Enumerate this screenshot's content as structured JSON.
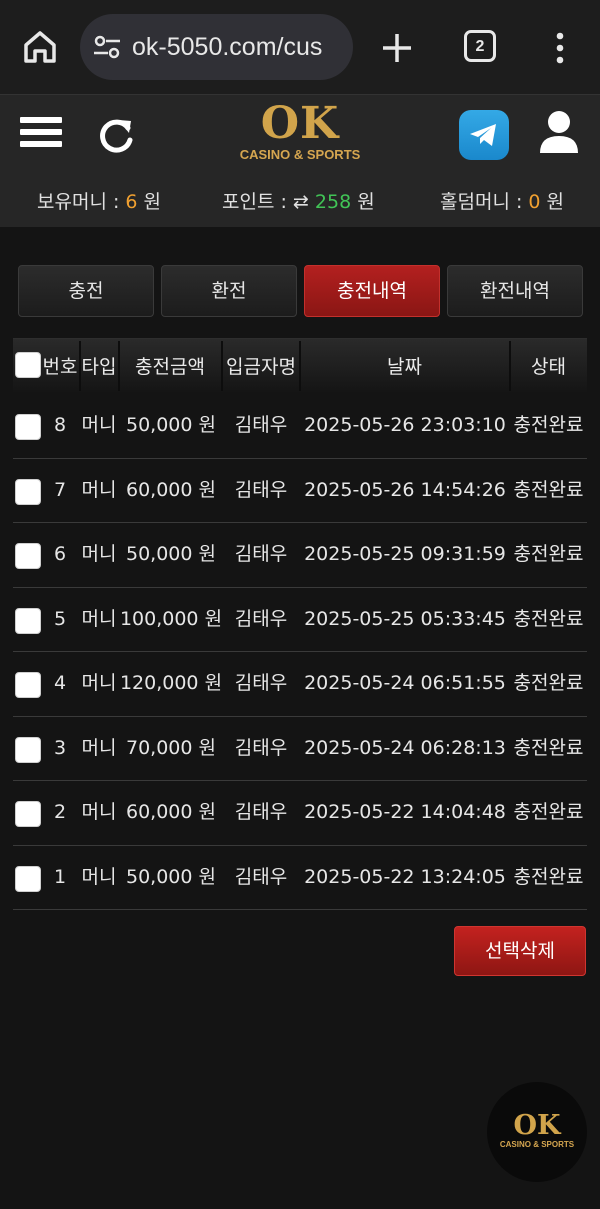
{
  "browser": {
    "url": "ok-5050.com/cus",
    "tab_count": "2"
  },
  "header": {
    "logo_main": "OK",
    "logo_sub": "CASINO & SPORTS",
    "balance": {
      "label": "보유머니 : ",
      "value": "6",
      "unit": " 원"
    },
    "points": {
      "label": "포인트 : ",
      "icon": "⇄",
      "value": "258",
      "unit": " 원"
    },
    "holdem": {
      "label": "홀덤머니 : ",
      "value": "0",
      "unit": " 원"
    },
    "colors": {
      "orange": "#f0a030",
      "green": "#41c456",
      "active_tab": "#a81d1b"
    }
  },
  "tabs": [
    {
      "label": "충전",
      "active": false
    },
    {
      "label": "환전",
      "active": false
    },
    {
      "label": "충전내역",
      "active": true
    },
    {
      "label": "환전내역",
      "active": false
    }
  ],
  "table": {
    "headers": [
      "번호",
      "타입",
      "충전금액",
      "입금자명",
      "날짜",
      "상태"
    ],
    "rows": [
      {
        "no": "8",
        "type": "머니",
        "amount": "50,000 원",
        "depositor": "김태우",
        "date": "2025-05-26 23:03:10",
        "status": "충전완료"
      },
      {
        "no": "7",
        "type": "머니",
        "amount": "60,000 원",
        "depositor": "김태우",
        "date": "2025-05-26 14:54:26",
        "status": "충전완료"
      },
      {
        "no": "6",
        "type": "머니",
        "amount": "50,000 원",
        "depositor": "김태우",
        "date": "2025-05-25 09:31:59",
        "status": "충전완료"
      },
      {
        "no": "5",
        "type": "머니",
        "amount": "100,000 원",
        "depositor": "김태우",
        "date": "2025-05-25 05:33:45",
        "status": "충전완료"
      },
      {
        "no": "4",
        "type": "머니",
        "amount": "120,000 원",
        "depositor": "김태우",
        "date": "2025-05-24 06:51:55",
        "status": "충전완료"
      },
      {
        "no": "3",
        "type": "머니",
        "amount": "70,000 원",
        "depositor": "김태우",
        "date": "2025-05-24 06:28:13",
        "status": "충전완료"
      },
      {
        "no": "2",
        "type": "머니",
        "amount": "60,000 원",
        "depositor": "김태우",
        "date": "2025-05-22 14:04:48",
        "status": "충전완료"
      },
      {
        "no": "1",
        "type": "머니",
        "amount": "50,000 원",
        "depositor": "김태우",
        "date": "2025-05-22 13:24:05",
        "status": "충전완료"
      }
    ]
  },
  "delete_button": "선택삭제",
  "float_logo": {
    "main": "OK",
    "sub": "CASINO & SPORTS"
  }
}
